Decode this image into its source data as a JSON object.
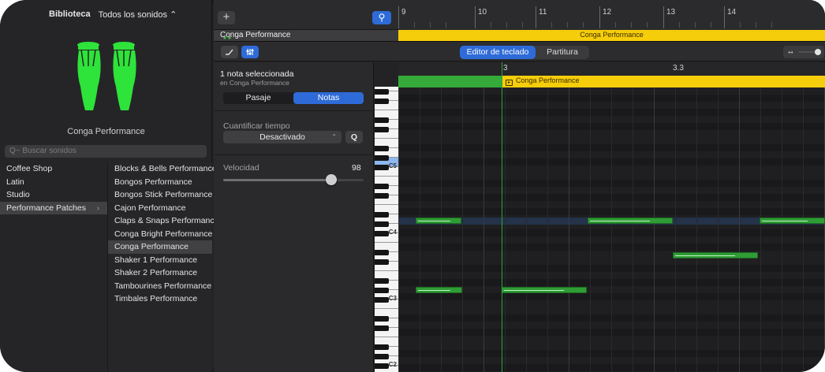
{
  "library": {
    "title": "Biblioteca",
    "sounds_filter": "Todos los sonidos ⌃",
    "patch_name": "Conga Performance",
    "search_placeholder": "Q~ Buscar sonidos",
    "categories": [
      {
        "label": "Coffee Shop",
        "selected": false
      },
      {
        "label": "Latin",
        "selected": false
      },
      {
        "label": "Studio",
        "selected": false
      },
      {
        "label": "Performance Patches",
        "selected": true
      }
    ],
    "patches": [
      {
        "label": "Blocks & Bells Performance",
        "selected": false
      },
      {
        "label": "Bongos Performance",
        "selected": false
      },
      {
        "label": "Bongos Stick Performance",
        "selected": false
      },
      {
        "label": "Cajon Performance",
        "selected": false
      },
      {
        "label": "Claps & Snaps Performance",
        "selected": false
      },
      {
        "label": "Conga Bright Performance",
        "selected": false
      },
      {
        "label": "Conga Performance",
        "selected": true
      },
      {
        "label": "Shaker 1 Performance",
        "selected": false
      },
      {
        "label": "Shaker 2 Performance",
        "selected": false
      },
      {
        "label": "Tambourines Performance",
        "selected": false
      },
      {
        "label": "Timbales Performance",
        "selected": false
      }
    ],
    "chevron": "›",
    "instrument_icon": "conga-drums-icon",
    "instrument_color": "#2ee33a"
  },
  "tracks": {
    "add_label": "+",
    "track_name": "Conga Performance",
    "region_label": "Conga Performance",
    "region_color": "#f6cd0b",
    "bar_numbers": [
      "9",
      "10",
      "11",
      "12",
      "13",
      "14"
    ]
  },
  "editor": {
    "tab_piano_roll": "Editor de teclado",
    "tab_score": "Partitura",
    "catch_icon": "catch-playhead-icon",
    "filter_icon": "smart-controls-icon",
    "zoom_icon": "horizontal-zoom-icon"
  },
  "inspector": {
    "selection_title": "1 nota seleccionada",
    "selection_sub": "en Conga Performance",
    "tab_region": "Pasaje",
    "tab_notes": "Notas",
    "quantize_label": "Cuantificar tiempo",
    "quantize_value": "Desactivado",
    "quantize_button": "Q",
    "velocity_label": "Velocidad",
    "velocity_value": "98",
    "velocity_fraction": 0.77
  },
  "piano_roll": {
    "ruler_labels": [
      "3",
      "3.3"
    ],
    "region_label": "Conga Performance",
    "octave_labels": [
      "C5",
      "C4",
      "C3",
      "C2"
    ],
    "note_color": "#2f9c35",
    "accent_color": "#2e6bd8"
  }
}
